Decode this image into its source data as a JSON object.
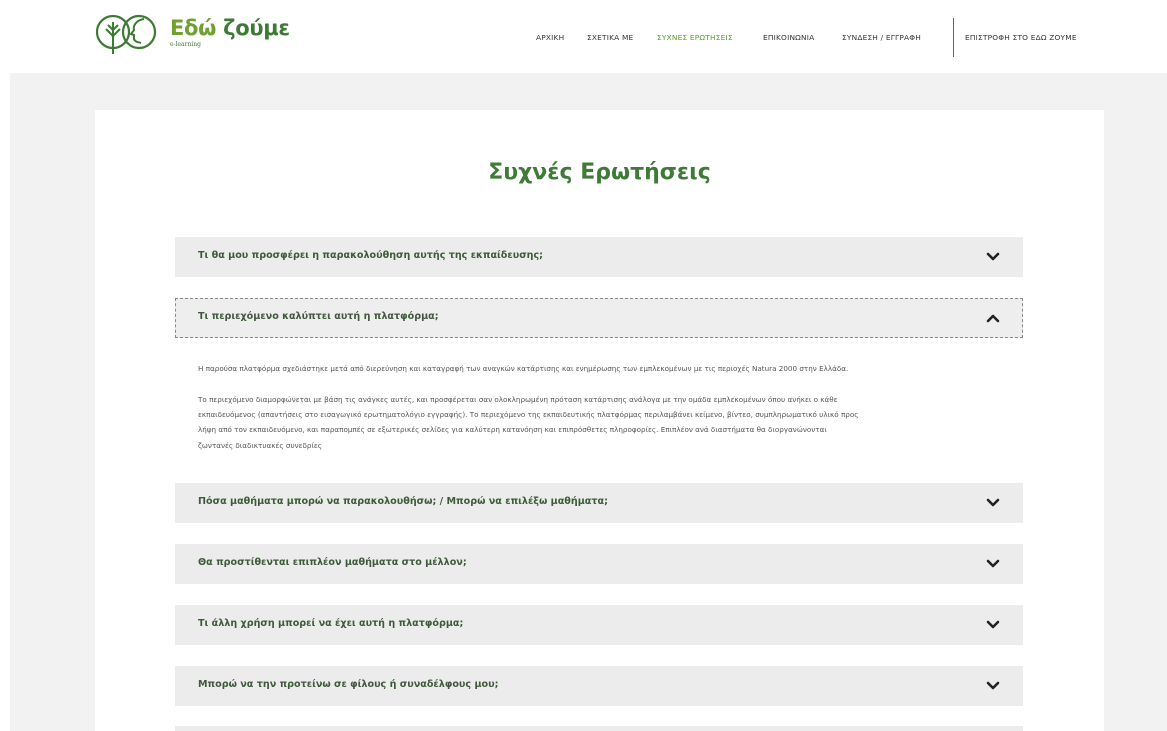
{
  "brand": {
    "name_part1": "Εδώ",
    "name_part2": "ζούμε",
    "subtitle": "e-learning",
    "logo_icon": "leaf-face-circles-icon"
  },
  "nav": {
    "items": [
      {
        "label": "ΑΡΧΙΚΗ",
        "active": false
      },
      {
        "label": "ΣΧΕΤΙΚΑ ΜΕ",
        "active": false
      },
      {
        "label": "ΣΥΧΝΕΣ ΕΡΩΤΗΣΕΙΣ",
        "active": true
      },
      {
        "label": "ΕΠΙΚΟΙΝΩΝΙΑ",
        "active": false
      },
      {
        "label": "ΣΥΝΔΕΣΗ / ΕΓΓΡΑΦΗ",
        "active": false
      },
      {
        "label": "ΕΠΙΣΤΡΟΦΗ ΣΤΟ ΕΔΩ ΖΟΥΜΕ",
        "active": false
      }
    ]
  },
  "page": {
    "title": "Συχνές Ερωτήσεις"
  },
  "faq": [
    {
      "question": "Τι θα μου προσφέρει η παρακολούθηση αυτής της εκπαίδευσης;",
      "open": false
    },
    {
      "question": "Τι περιεχόμενο καλύπτει αυτή η πλατφόρμα;",
      "open": true,
      "answer_p1": "Η παρούσα πλατφόρμα σχεδιάστηκε μετά από διερεύνηση και καταγραφή των αναγκών κατάρτισης και ενημέρωσης των εμπλεκομένων με τις περιοχές Natura 2000 στην Ελλάδα.",
      "answer_p2_lines": [
        "Το περιεχόμενο διαμορφώνεται με βάση τις ανάγκες αυτές, και προσφέρεται σαν ολοκληρωμένη πρόταση κατάρτισης ανάλογα με την ομάδα εμπλεκομένων όπου ανήκει ο κάθε",
        "εκπαιδευόμενος (απαντήσεις στο εισαγωγικό ερωτηματολόγιο εγγραφής). Το περιεχόμενο της εκπαιδευτικής πλατφόρμας περιλαμβάνει κείμενο, βίντεο, συμπληρωματικό υλικό προς",
        "λήψη από τον εκπαιδευόμενο, και παραπομπές σε εξωτερικές σελίδες για καλύτερη κατανόηση και επιπρόσθετες πληροφορίες. Επιπλέον ανά διαστήματα θα διοργανώνονται",
        "ζωντανές διαδικτυακές συνεδρίες"
      ]
    },
    {
      "question": "Πόσα μαθήματα μπορώ να παρακολουθήσω; / Μπορώ να επιλέξω μαθήματα;",
      "open": false
    },
    {
      "question": "Θα προστίθενται επιπλέον μαθήματα στο μέλλον;",
      "open": false
    },
    {
      "question": "Τι άλλη χρήση μπορεί να έχει αυτή η πλατφόρμα;",
      "open": false
    },
    {
      "question": "Μπορώ να την προτείνω σε φίλους ή συναδέλφους μου;",
      "open": false
    }
  ],
  "colors": {
    "brand_green": "#3d7a33",
    "nav_active": "#5c9a2e",
    "question_text": "#3e5a3a",
    "accordion_bg": "#ececec"
  }
}
